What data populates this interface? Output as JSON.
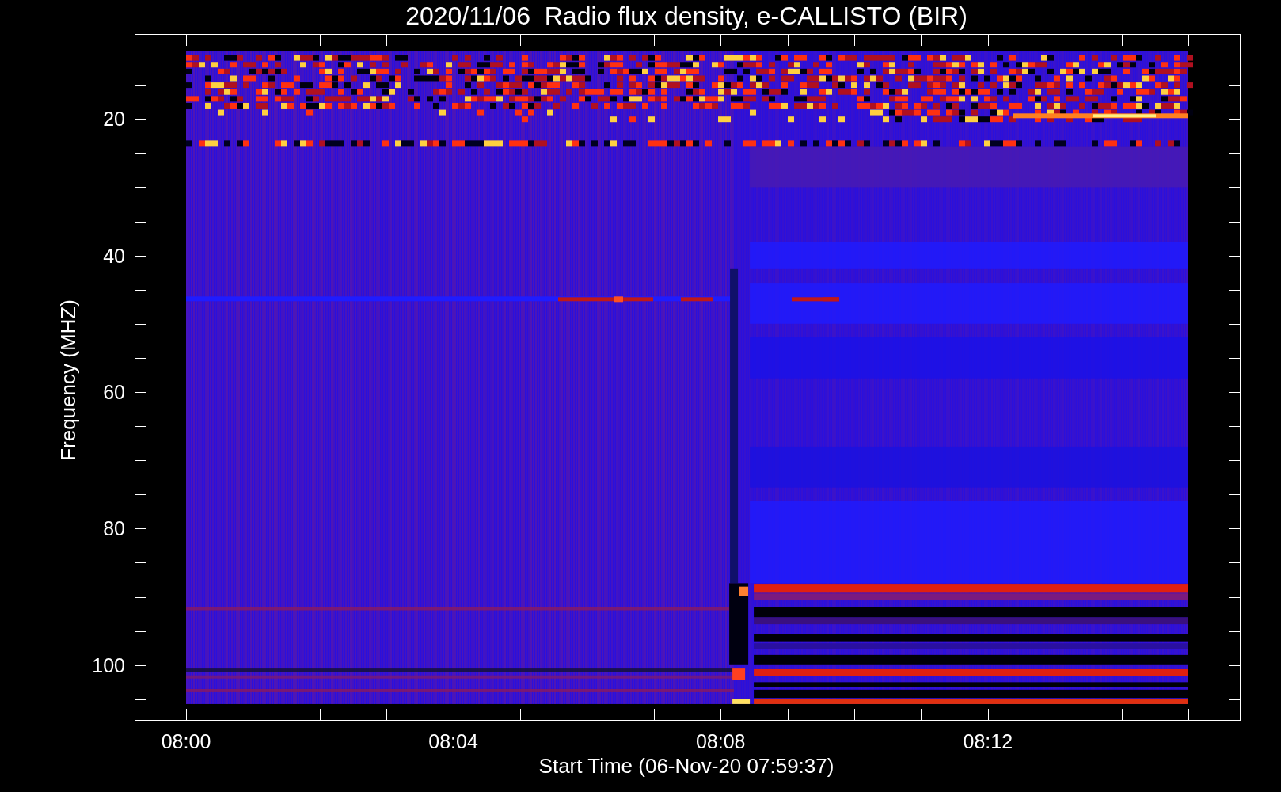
{
  "plot": {
    "title": "2020/11/06  Radio flux density, e-CALLISTO (BIR)",
    "ylabel": "Frequency (MHZ)",
    "xlabel": "Start Time (06-Nov-20 07:59:37)",
    "yticks": [
      "20",
      "40",
      "60",
      "80",
      "100"
    ],
    "xticks": [
      "08:00",
      "08:04",
      "08:08",
      "08:12"
    ]
  }
}
